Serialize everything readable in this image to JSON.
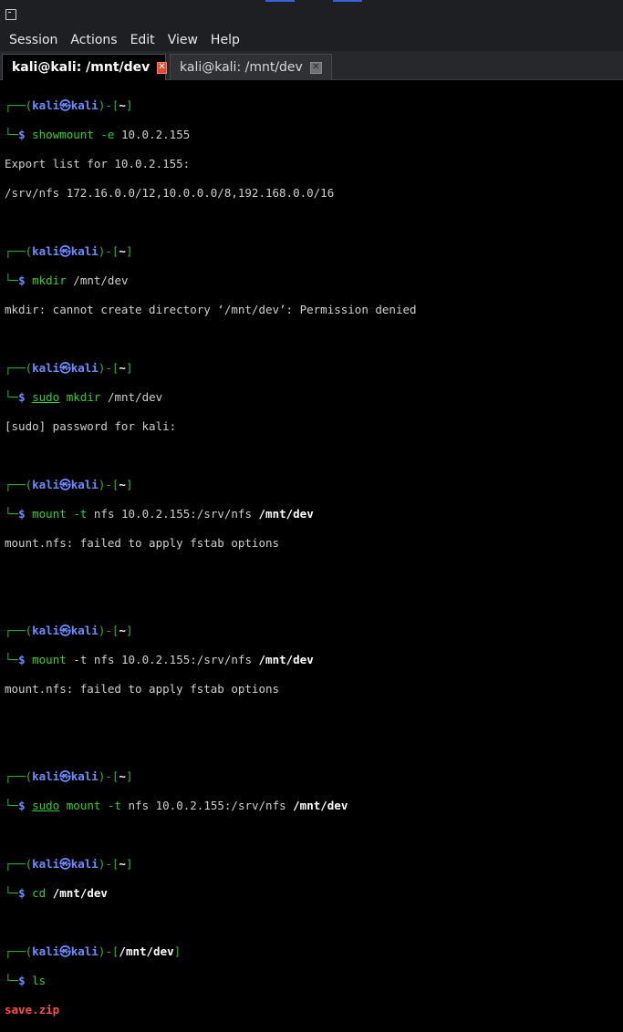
{
  "menu": [
    "Session",
    "Actions",
    "Edit",
    "View",
    "Help"
  ],
  "tabs": [
    {
      "label": "kali@kali: /mnt/dev",
      "close": "✕"
    },
    {
      "label": "kali@kali: /mnt/dev",
      "close": "✕"
    }
  ],
  "prompt": {
    "user": "kali",
    "at": "㉿",
    "host": "kali",
    "dollar": "$",
    "home": "~",
    "mntdev": "/mnt/dev"
  },
  "commands": {
    "c1": {
      "cmd": "showmount",
      "flag": "-e",
      "args": "10.0.2.155"
    },
    "c2": {
      "cmd": "mkdir",
      "args": "/mnt/dev"
    },
    "c3": {
      "sudo": "sudo",
      "cmd": "mkdir",
      "args": "/mnt/dev"
    },
    "c4": {
      "cmd": "mount",
      "flag": "-t",
      "args": "nfs 10.0.2.155:/srv/nfs",
      "target": "/mnt/dev"
    },
    "c5": {
      "cmd": "mount",
      "flag": "-t",
      "args": "nfs 10.0.2.155:/srv/nfs",
      "target": "/mnt/dev"
    },
    "c6": {
      "sudo": "sudo",
      "cmd": "mount",
      "flag": "-t",
      "args": "nfs 10.0.2.155:/srv/nfs",
      "target": "/mnt/dev"
    },
    "c7": {
      "cmd": "cd",
      "target": "/mnt/dev"
    },
    "c8": {
      "cmd": "ls"
    }
  },
  "output": {
    "o1a": "Export list for 10.0.2.155:",
    "o1b": "/srv/nfs 172.16.0.0/12,10.0.0.0/8,192.168.0.0/16",
    "o2": "mkdir: cannot create directory ‘/mnt/dev’: Permission denied",
    "o3": "[sudo] password for kali:",
    "o4": "mount.nfs: failed to apply fstab options",
    "o5": "mount.nfs: failed to apply fstab options",
    "o8": "save.zip"
  },
  "colors": {
    "prompt_green": "#2fb82f",
    "user_blue": "#6b8cff",
    "error_red": "#ff4d4d",
    "tab_close_red": "#e04b33"
  }
}
